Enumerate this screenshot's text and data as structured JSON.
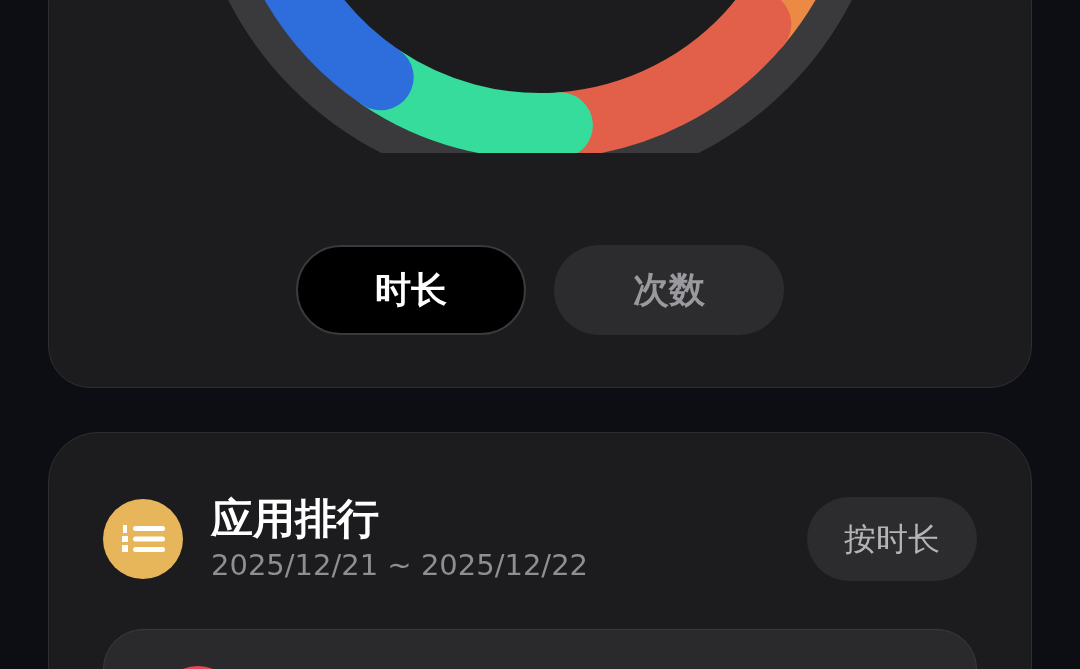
{
  "usage_card": {
    "tabs": [
      {
        "label": "时长",
        "selected": true
      },
      {
        "label": "次数",
        "selected": false
      }
    ]
  },
  "ranking_card": {
    "title": "应用排行",
    "date_range": "2025/12/21 ~ 2025/12/22",
    "sort_button": "按时长"
  }
}
